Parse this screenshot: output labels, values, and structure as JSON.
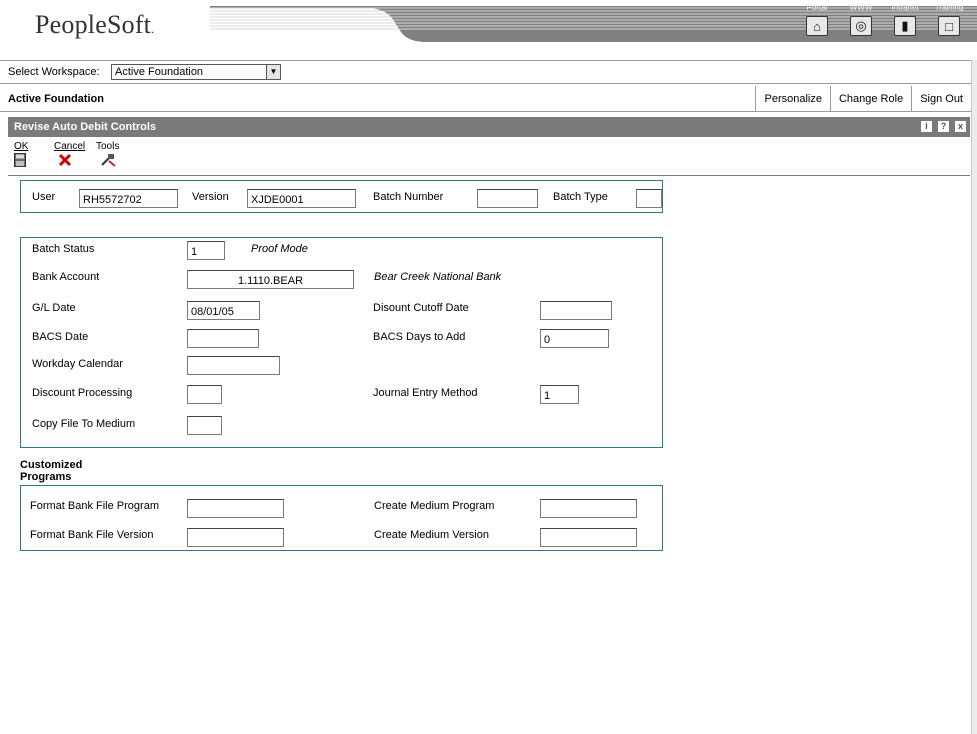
{
  "brand": {
    "logo": "PeopleSoft",
    "reg": "."
  },
  "nav": [
    {
      "label": "Portal",
      "icon": "home-icon",
      "glyph": "⌂"
    },
    {
      "label": "WWW",
      "icon": "globe-icon",
      "glyph": "◎"
    },
    {
      "label": "Intranet",
      "icon": "book-icon",
      "glyph": "▮"
    },
    {
      "label": "Training",
      "icon": "monitor-icon",
      "glyph": "□"
    }
  ],
  "workspace": {
    "label": "Select Workspace:",
    "value": "Active Foundation"
  },
  "header": {
    "title": "Active Foundation",
    "personalize": "Personalize",
    "change_role": "Change Role",
    "sign_out": "Sign Out"
  },
  "app": {
    "title": "Revise Auto Debit Controls",
    "icons": [
      {
        "name": "info-icon",
        "glyph": "i"
      },
      {
        "name": "help-icon",
        "glyph": "?"
      },
      {
        "name": "close-window-icon",
        "glyph": "x"
      }
    ]
  },
  "toolbar": {
    "ok": "OK",
    "cancel": "Cancel",
    "tools": "Tools"
  },
  "header_fields": {
    "user_label": "User",
    "user_value": "RH5572702",
    "version_label": "Version",
    "version_value": "XJDE0001",
    "batch_number_label": "Batch Number",
    "batch_number_value": "",
    "batch_type_label": "Batch Type",
    "batch_type_value": ""
  },
  "main_fields": {
    "batch_status_label": "Batch Status",
    "batch_status_value": "1",
    "batch_status_desc": "Proof Mode",
    "bank_account_label": "Bank Account",
    "bank_account_value": "1.1110.BEAR",
    "bank_account_desc": "Bear Creek National Bank",
    "gl_date_label": "G/L Date",
    "gl_date_value": "08/01/05",
    "discount_cutoff_label": "Disount Cutoff Date",
    "discount_cutoff_value": "",
    "bacs_date_label": "BACS Date",
    "bacs_date_value": "",
    "bacs_days_label": "BACS Days to Add",
    "bacs_days_value": "0",
    "workday_calendar_label": "Workday Calendar",
    "workday_calendar_value": "",
    "discount_processing_label": "Discount Processing",
    "discount_processing_value": "",
    "journal_entry_label": "Journal Entry Method",
    "journal_entry_value": "1",
    "copy_file_label": "Copy File To Medium",
    "copy_file_value": ""
  },
  "customized": {
    "section_line1": "Customized",
    "section_line2": "Programs",
    "format_program_label": "Format Bank File Program",
    "format_program_value": "",
    "create_program_label": "Create Medium Program",
    "create_program_value": "",
    "format_version_label": "Format Bank File Version",
    "format_version_value": "",
    "create_version_label": "Create Medium Version",
    "create_version_value": ""
  }
}
